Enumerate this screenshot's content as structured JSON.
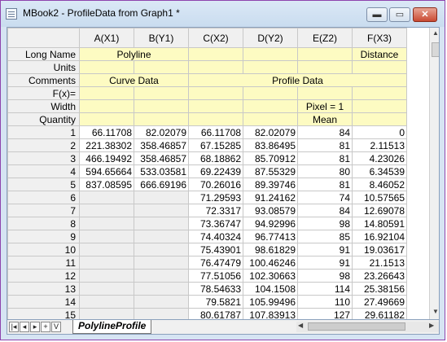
{
  "window": {
    "title": "MBook2 - ProfileData from Graph1 *",
    "buttons": {
      "minimize": "▬",
      "maximize": "▭",
      "close": "✕"
    }
  },
  "columns": [
    "A(X1)",
    "B(Y1)",
    "C(X2)",
    "D(Y2)",
    "E(Z2)",
    "F(X3)"
  ],
  "meta_labels": [
    "Long Name",
    "Units",
    "Comments",
    "F(x)=",
    "Width",
    "Quantity"
  ],
  "meta_values": {
    "long_name_ab": "Polyline",
    "long_name_f": "Distance",
    "comments_ab": "Curve Data",
    "comments_cdef": "Profile Data",
    "width_e": "Pixel = 1",
    "quantity_e": "Mean"
  },
  "rows": [
    [
      "1",
      "66.11708",
      "82.02079",
      "66.11708",
      "82.02079",
      "84",
      "0"
    ],
    [
      "2",
      "221.38302",
      "358.46857",
      "67.15285",
      "83.86495",
      "81",
      "2.11513"
    ],
    [
      "3",
      "466.19492",
      "358.46857",
      "68.18862",
      "85.70912",
      "81",
      "4.23026"
    ],
    [
      "4",
      "594.65664",
      "533.03581",
      "69.22439",
      "87.55329",
      "80",
      "6.34539"
    ],
    [
      "5",
      "837.08595",
      "666.69196",
      "70.26016",
      "89.39746",
      "81",
      "8.46052"
    ],
    [
      "6",
      "",
      "",
      "71.29593",
      "91.24162",
      "74",
      "10.57565"
    ],
    [
      "7",
      "",
      "",
      "72.3317",
      "93.08579",
      "84",
      "12.69078"
    ],
    [
      "8",
      "",
      "",
      "73.36747",
      "94.92996",
      "98",
      "14.80591"
    ],
    [
      "9",
      "",
      "",
      "74.40324",
      "96.77413",
      "85",
      "16.92104"
    ],
    [
      "10",
      "",
      "",
      "75.43901",
      "98.61829",
      "91",
      "19.03617"
    ],
    [
      "11",
      "",
      "",
      "76.47479",
      "100.46246",
      "91",
      "21.1513"
    ],
    [
      "12",
      "",
      "",
      "77.51056",
      "102.30663",
      "98",
      "23.26643"
    ],
    [
      "13",
      "",
      "",
      "78.54633",
      "104.1508",
      "114",
      "25.38156"
    ],
    [
      "14",
      "",
      "",
      "79.5821",
      "105.99496",
      "110",
      "27.49669"
    ],
    [
      "15",
      "",
      "",
      "80.61787",
      "107.83913",
      "127",
      "29.61182"
    ]
  ],
  "sheet_nav": {
    "first": "|◂",
    "prev": "◂",
    "next": "▸",
    "add": "+",
    "menu": "V"
  },
  "sheet_tab": "PolylineProfile"
}
